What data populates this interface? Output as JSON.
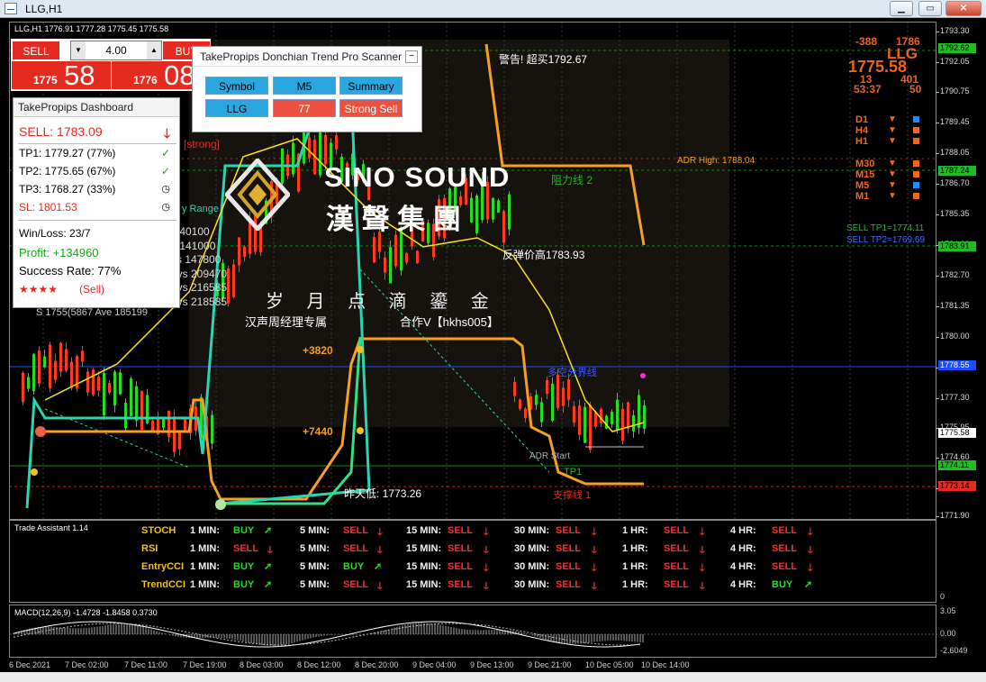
{
  "window": {
    "title": "LLG,H1"
  },
  "chart_header": {
    "ohlc": "LLG,H1  1776.91 1777.28 1775.45 1775.58"
  },
  "trade_panel": {
    "sell_label": "SELL",
    "buy_label": "BUY",
    "lot": "4.00",
    "sell_small": "1775",
    "sell_big": "58",
    "buy_small": "1776",
    "buy_big": "08"
  },
  "dashboard": {
    "title": "TakePropips Dashboard",
    "signal": "SELL: 1783.09",
    "tp1": "TP1: 1779.27 (77%)",
    "tp2": "TP2: 1775.65 (67%)",
    "tp3": "TP3: 1768.27 (33%)",
    "sl": "SL:  1801.53",
    "winloss": "Win/Loss: 23/7",
    "profit": "Profit: +134960",
    "success": "Success Rate: 77%",
    "stars": "★★★★",
    "stars_signal": "(Sell)"
  },
  "scanner": {
    "title": "TakePropips Donchian Trend Pro Scanner",
    "headers": [
      "Symbol",
      "M5",
      "Summary"
    ],
    "row": [
      "LLG",
      "77",
      "Strong Sell"
    ]
  },
  "watermark": {
    "brand": "SINO SOUND",
    "group": "漢 聲 集 團",
    "slogan": "岁 月 点 滴 鎏 金",
    "manager": "汉声周经理专属",
    "contact": "合作V【hkhs005】"
  },
  "chart_labels": {
    "alert": "警告! 超买1792.67",
    "resist2": "阻力线 2",
    "rebound": "反弹价高1783.93",
    "pivot": "多空分界线",
    "adr_high": "ADR High: 1788.04",
    "adr_start": "ADR Start",
    "tp1": "TP1",
    "support1": "支撑线 1",
    "yest_low": "昨天低: 1773.26",
    "plus3820": "+3820",
    "plus7440": "+7440",
    "strong": "[strong]",
    "range": "y Range",
    "sell_tp1": "SELL TP1=1774.11",
    "sell_tp2": "SELL TP2=1769.69",
    "ranges": [
      "y   40100",
      "y   141000",
      "ys  147800",
      "ays  209470",
      "ays  216585",
      "ays  218585"
    ],
    "bottom_left": "S     1755(5867     Ave    185199"
  },
  "mtf_panel": {
    "a": "-388",
    "b": "1786",
    "sym": "LLG",
    "price": "1775.58",
    "c": "13",
    "d": "401",
    "time": "53:37",
    "e": "50",
    "tfs": [
      "D1",
      "H4",
      "H1",
      "M30",
      "M15",
      "M5",
      "M1"
    ]
  },
  "price_axis": {
    "ticks": [
      "1793.30",
      "1792.05",
      "1790.75",
      "1789.45",
      "1788.05",
      "1786.70",
      "1785.35",
      "1784.00",
      "1782.70",
      "1781.35",
      "1780.00",
      "1778.65",
      "1777.30",
      "1775.95",
      "1774.60",
      "1773.25",
      "1771.90"
    ],
    "labels": [
      "1792.62",
      "1787.24",
      "1783.91",
      "1778.55",
      "1775.58",
      "1774.11",
      "1773.14"
    ]
  },
  "trade_assistant": {
    "title": "Trade Assistant 1.14",
    "timeframes": [
      "1 MIN:",
      "5 MIN:",
      "15 MIN:",
      "30 MIN:",
      "1 HR:",
      "4 HR:"
    ],
    "rows": [
      {
        "name": "STOCH",
        "signals": [
          "BUY",
          "SELL",
          "SELL",
          "SELL",
          "SELL",
          "SELL"
        ]
      },
      {
        "name": "RSI",
        "signals": [
          "SELL",
          "SELL",
          "SELL",
          "SELL",
          "SELL",
          "SELL"
        ]
      },
      {
        "name": "EntryCCI",
        "signals": [
          "BUY",
          "BUY",
          "SELL",
          "SELL",
          "SELL",
          "SELL"
        ]
      },
      {
        "name": "TrendCCI",
        "signals": [
          "BUY",
          "SELL",
          "SELL",
          "SELL",
          "SELL",
          "BUY"
        ]
      }
    ],
    "zero": "0"
  },
  "macd": {
    "title": "MACD(12,26,9) -1.4728 -1.8458 0.3730",
    "ticks": [
      "3.05",
      "0.00",
      "-2.6049"
    ]
  },
  "time_axis": [
    "6 Dec 2021",
    "7 Dec 02:00",
    "7 Dec 11:00",
    "7 Dec 19:00",
    "8 Dec 03:00",
    "8 Dec 12:00",
    "8 Dec 20:00",
    "9 Dec 04:00",
    "9 Dec 13:00",
    "9 Dec 21:00",
    "10 Dec 05:00",
    "10 Dec 14:00"
  ],
  "colors": {
    "sell": "#e52a20",
    "buy": "#14a814",
    "orange": "#f5a020",
    "cyan": "#2bd5b0",
    "blue": "#1a4dff",
    "green_line": "#00a000"
  }
}
